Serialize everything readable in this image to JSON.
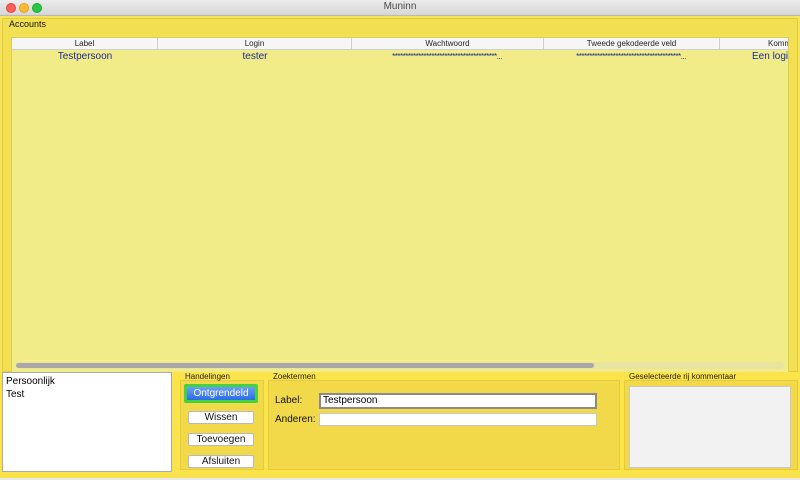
{
  "window": {
    "title": "Muninn"
  },
  "accounts": {
    "title": "Accounts",
    "columns": [
      "Label",
      "Login",
      "Wachtwoord",
      "Tweede gekodeerde veld",
      "Komm"
    ],
    "rows": [
      {
        "label": "Testpersoon",
        "login": "tester",
        "wachtwoord": "****************************************...",
        "tweede": "****************************************...",
        "kommentaar": "Een login"
      }
    ]
  },
  "categories": [
    "Persoonlijk",
    "Test"
  ],
  "handelingen": {
    "title": "Handelingen",
    "ontgrendeld": "Ontgrendeld",
    "wissen": "Wissen",
    "toevoegen": "Toevoegen",
    "afsluiten": "Afsluiten"
  },
  "zoektermen": {
    "title": "Zoektermen",
    "label_label": "Label:",
    "label_value": "Testpersoon",
    "anderen_label": "Anderen:",
    "anderen_value": ""
  },
  "kommentaar": {
    "title": "Geselecteerde rij kommentaar",
    "value": ""
  }
}
